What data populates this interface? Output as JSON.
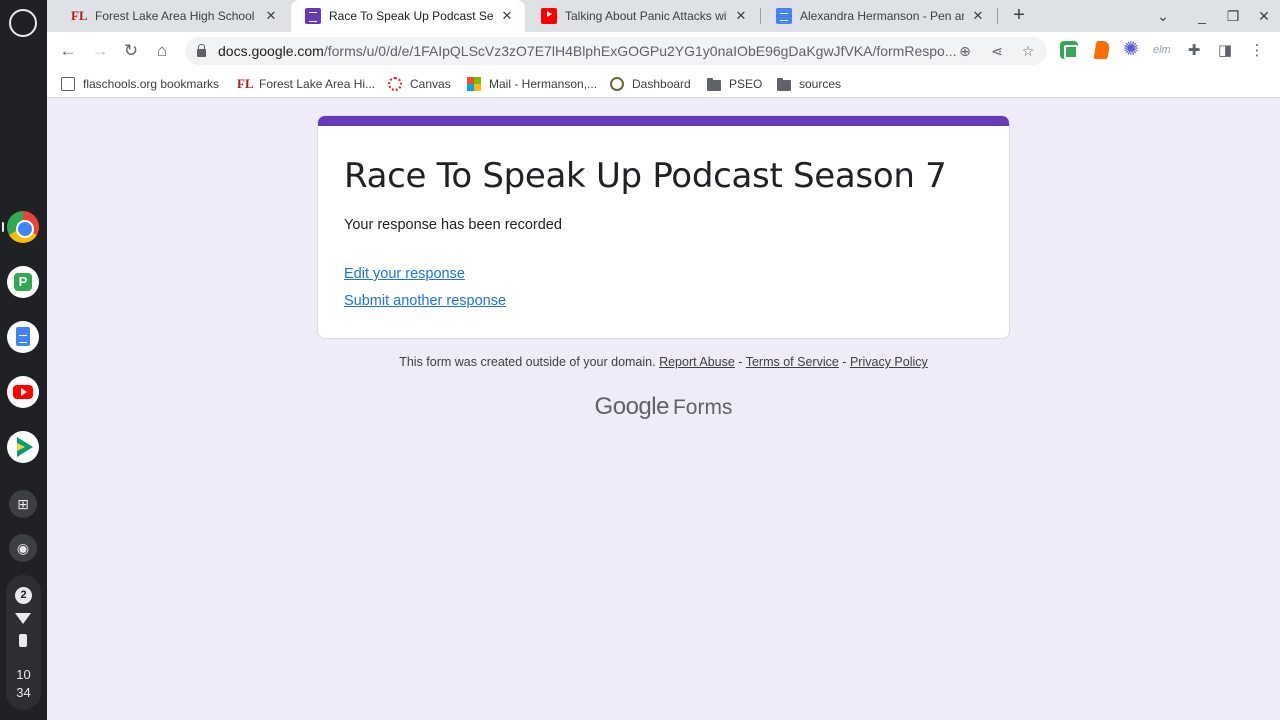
{
  "shelf": {
    "notification_count": "2",
    "time_hour": "10",
    "time_minute": "34"
  },
  "tabs": [
    {
      "title": "Forest Lake Area High School / H",
      "favicon": "flhs-logo-icon",
      "active": false
    },
    {
      "title": "Race To Speak Up Podcast Seas",
      "favicon": "google-forms-icon",
      "active": true
    },
    {
      "title": "Talking About Panic Attacks with",
      "favicon": "youtube-icon",
      "active": false
    },
    {
      "title": "Alexandra Hermanson - Pen and",
      "favicon": "google-docs-icon",
      "active": false
    }
  ],
  "omnibox": {
    "domain": "docs.google.com",
    "path": "/forms/u/0/d/e/1FAIpQLScVz3zO7E7lH4BlphExGOGPu2YG1y0naIObE96gDaKgwJfVKA/formRespo..."
  },
  "bookmarks": [
    {
      "label": "flaschools.org bookmarks",
      "icon": "bookmarks-icon"
    },
    {
      "label": "Forest Lake Area Hi...",
      "icon": "flhs-logo-icon"
    },
    {
      "label": "Canvas",
      "icon": "canvas-icon"
    },
    {
      "label": "Mail - Hermanson,...",
      "icon": "microsoft-icon"
    },
    {
      "label": "Dashboard",
      "icon": "dashboard-icon"
    },
    {
      "label": "PSEO",
      "icon": "folder-icon"
    },
    {
      "label": "sources",
      "icon": "folder-icon"
    }
  ],
  "form": {
    "title": "Race To Speak Up Podcast Season 7",
    "confirmation": "Your response has been recorded",
    "edit_link": "Edit your response",
    "submit_another_link": "Submit another response"
  },
  "footer": {
    "notice": "This form was created outside of your domain.",
    "report_abuse": "Report Abuse",
    "separator": "-",
    "terms": "Terms of Service",
    "privacy": "Privacy Policy"
  },
  "brand": {
    "google": "Google",
    "forms": "Forms"
  },
  "colors": {
    "form_accent": "#673ab7",
    "page_background": "#f0ebf8",
    "link": "#1a73e8"
  }
}
